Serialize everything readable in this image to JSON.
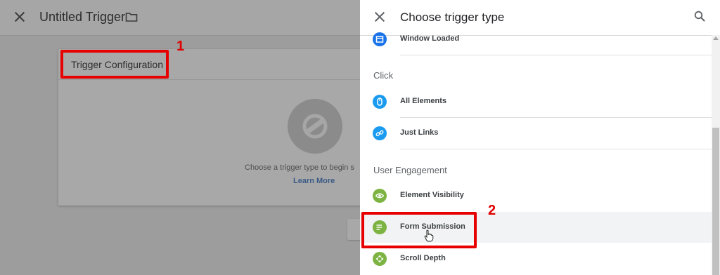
{
  "editor": {
    "trigger_name": "Untitled Trigger",
    "card_title": "Trigger Configuration",
    "choose_prompt": "Choose a trigger type to begin s",
    "learn_more": "Learn More"
  },
  "panel": {
    "title": "Choose trigger type",
    "items": [
      {
        "label": "Window Loaded",
        "icon": "window-icon",
        "color": "#1a73e8"
      },
      {
        "label": "All Elements",
        "icon": "mouse-icon",
        "color": "#1a9bf0"
      },
      {
        "label": "Just Links",
        "icon": "link-icon",
        "color": "#1a9bf0"
      },
      {
        "label": "Element Visibility",
        "icon": "eye-icon",
        "color": "#7cb342"
      },
      {
        "label": "Form Submission",
        "icon": "form-icon",
        "color": "#7cb342"
      },
      {
        "label": "Scroll Depth",
        "icon": "scroll-icon",
        "color": "#7cb342"
      }
    ],
    "categories": [
      "Click",
      "User Engagement"
    ]
  },
  "annotations": {
    "step1": "1",
    "step2": "2",
    "highlight_color": "#e60000"
  }
}
